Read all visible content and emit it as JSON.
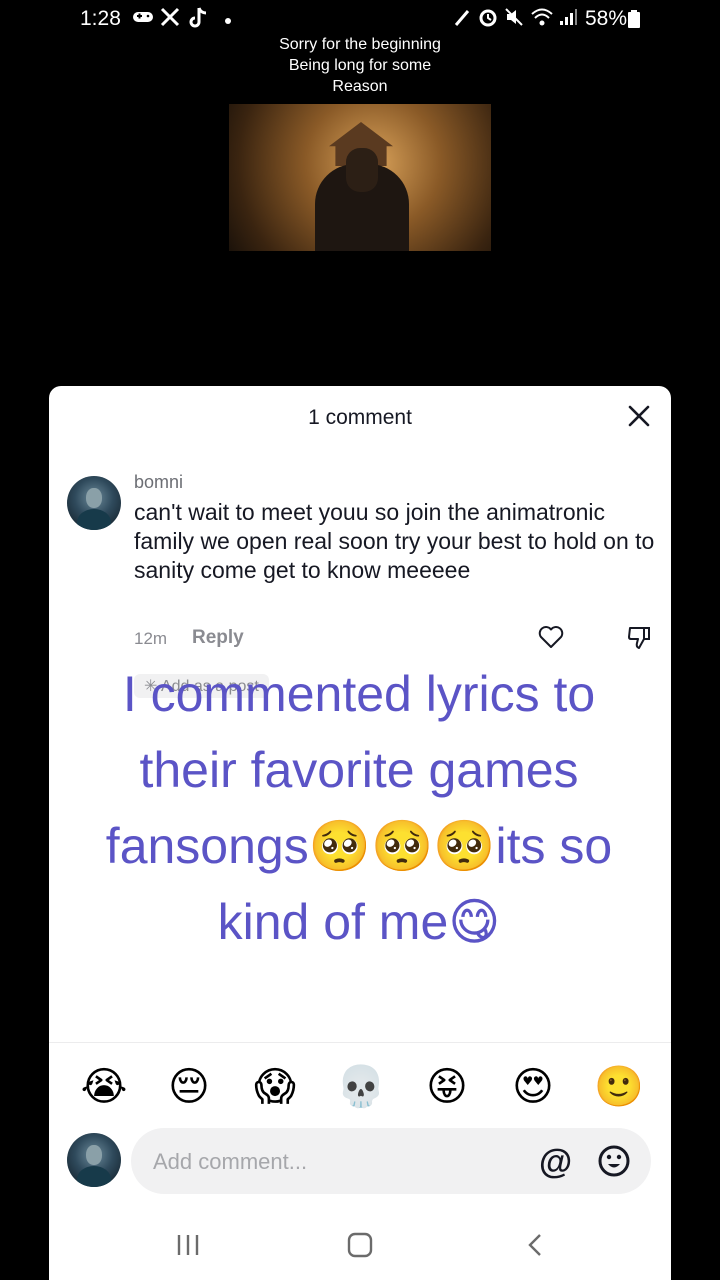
{
  "status_bar": {
    "time": "1:28",
    "battery": "58%"
  },
  "video": {
    "caption": [
      "Sorry for the beginning",
      "Being long for some",
      "Reason"
    ]
  },
  "sheet": {
    "title": "1 comment",
    "comment": {
      "username": "bomni",
      "text": "can't wait to meet youu so join the animatronic family we open real soon try your best to hold on to sanity come get to know meeeee",
      "time": "12m",
      "reply_label": "Reply",
      "add_post_label": "Add as a post"
    },
    "overlay_text": "I commented lyrics to their favorite games fansongs🥺🥺🥺its so kind of me😋",
    "emojis": [
      "😭",
      "😔",
      "😱",
      "💀",
      "😝",
      "😍",
      "🙂"
    ],
    "input_placeholder": "Add comment..."
  }
}
